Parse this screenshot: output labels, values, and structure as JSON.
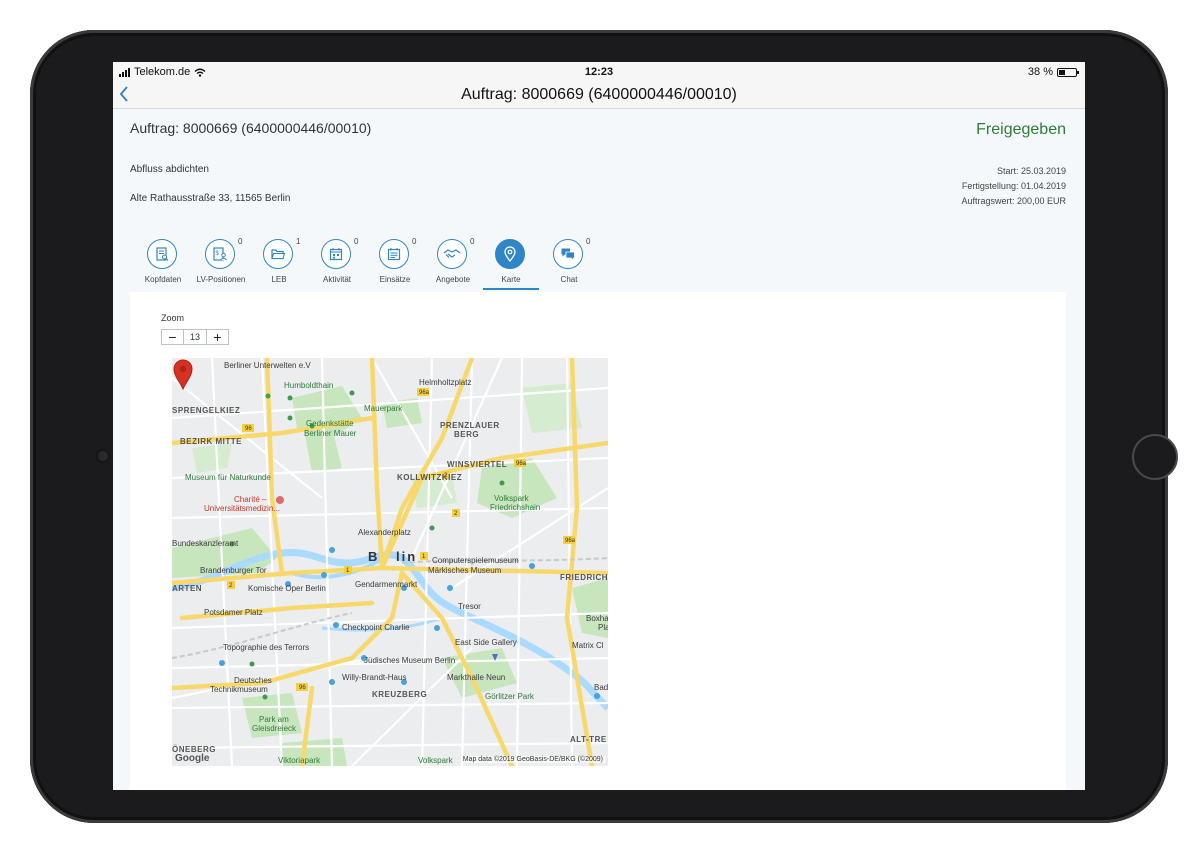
{
  "statusbar": {
    "carrier": "Telekom.de",
    "time": "12:23",
    "battery": "38 %"
  },
  "navbar": {
    "title": "Auftrag: 8000669 (6400000446/00010)"
  },
  "order": {
    "title": "Auftrag: 8000669 (6400000446/00010)",
    "status": "Freigegeben",
    "description": "Abfluss abdichten",
    "address": "Alte Rathausstraße 33, 11565 Berlin",
    "start": "Start: 25.03.2019",
    "completion": "Fertigstellung: 01.04.2019",
    "value": "Auftragswert: 200,00 EUR"
  },
  "tabs": [
    {
      "label": "Kopfdaten",
      "icon": "document-search-icon",
      "badge": ""
    },
    {
      "label": "LV-Positionen",
      "icon": "list-user-icon",
      "badge": "0"
    },
    {
      "label": "LEB",
      "icon": "folder-open-icon",
      "badge": "1"
    },
    {
      "label": "Aktivität",
      "icon": "calendar-icon",
      "badge": "0"
    },
    {
      "label": "Einsätze",
      "icon": "calendar-list-icon",
      "badge": "0"
    },
    {
      "label": "Angebote",
      "icon": "handshake-icon",
      "badge": "0"
    },
    {
      "label": "Karte",
      "icon": "map-pin-icon",
      "badge": ""
    },
    {
      "label": "Chat",
      "icon": "chat-icon",
      "badge": "0"
    }
  ],
  "zoom": {
    "label": "Zoom",
    "minus": "−",
    "value": "13",
    "plus": "+"
  },
  "map": {
    "labels": {
      "l1": "Berliner Unterwelten e.V",
      "l2": "Humboldthain",
      "l3": "Helmholtzplatz",
      "l4": "SPRENGELKIEZ",
      "l5": "Mauerpark",
      "l6": "BEZIRK MITTE",
      "l7": "Gedenkstätte",
      "l8": "Berliner Mauer",
      "l9": "PRENZLAUER",
      "l10": "BERG",
      "l11": "WINSVIERTEL",
      "l12": "KOLLWITZKIEZ",
      "l13": "Museum für Naturkunde",
      "l14": "Charité –",
      "l15": "Universitätsmedizin...",
      "l16": "Volkspark",
      "l17": "Friedrichshain",
      "l18": "Alexanderplatz",
      "l19": "Bundeskanzleramt",
      "l20": "B",
      "l21": "lin",
      "l22": "Computerspielemuseum",
      "l23": "Märkisches Museum",
      "l24": "Brandenburger Tor",
      "l25": "FRIEDRICHSHA",
      "l26": "ARTEN",
      "l27": "Komische Oper Berlin",
      "l28": "Gendarmenmarkt",
      "l29": "Potsdamer Platz",
      "l30": "Tresor",
      "l31": "Boxha",
      "l32": "Pla",
      "l33": "Checkpoint Charlie",
      "l34": "East Side Gallery",
      "l35": "Matrix Cl",
      "l36": "Topographie des Terrors",
      "l37": "Jüdisches Museum Berlin",
      "l38": "Deutsches",
      "l39": "Technikmuseum",
      "l40": "Willy-Brandt-Haus",
      "l41": "Markthalle Neun",
      "l42": "KREUZBERG",
      "l43": "Görlitzer Park",
      "l44": "Bad",
      "l45": "Park am",
      "l46": "Gleisdreieck",
      "l47": "ALT-TRE",
      "l48": "ÖNEBERG",
      "l49": "Viktoriapark",
      "l50": "Volkspark"
    },
    "google": "Google",
    "attribution": "Map data ©2019 GeoBasis-DE/BKG (©2009)"
  },
  "colors": {
    "accent": "#2f86c6",
    "status": "#2e7d32",
    "marker": "#d93025"
  }
}
